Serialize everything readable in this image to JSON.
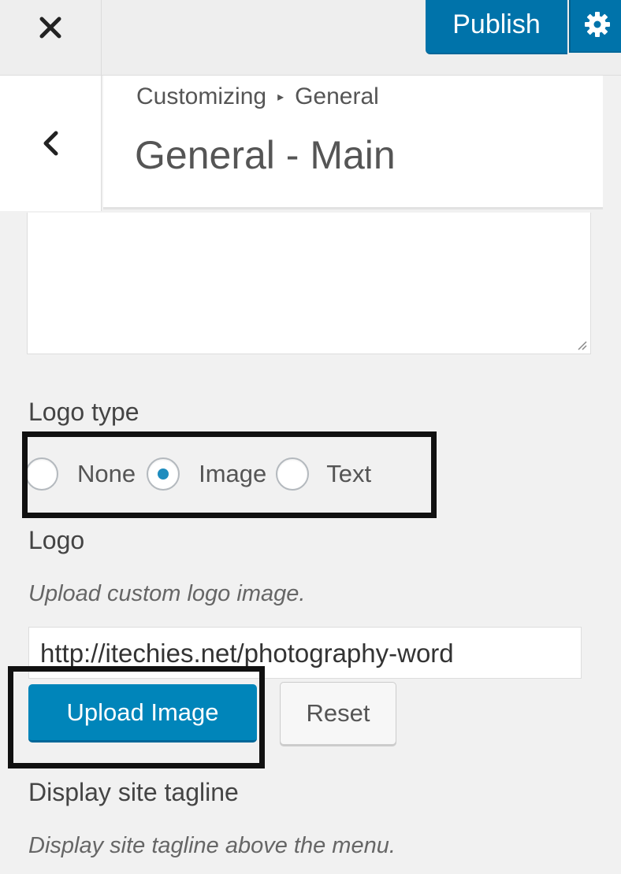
{
  "toolbar": {
    "close_icon": "close-icon",
    "publish_label": "Publish",
    "settings_icon": "gear-icon",
    "accent_color": "#0073aa"
  },
  "section": {
    "back_icon": "chevron-left-icon",
    "breadcrumb_root": "Customizing",
    "breadcrumb_current": "General",
    "title": "General - Main"
  },
  "logo_type": {
    "label": "Logo type",
    "options": [
      {
        "label": "None",
        "checked": false
      },
      {
        "label": "Image",
        "checked": true
      },
      {
        "label": "Text",
        "checked": false
      }
    ]
  },
  "logo": {
    "label": "Logo",
    "description": "Upload custom logo image.",
    "url_value": "http://itechies.net/photography-word",
    "upload_label": "Upload Image",
    "reset_label": "Reset"
  },
  "tagline": {
    "label": "Display site tagline",
    "description": "Display site tagline above the menu."
  }
}
